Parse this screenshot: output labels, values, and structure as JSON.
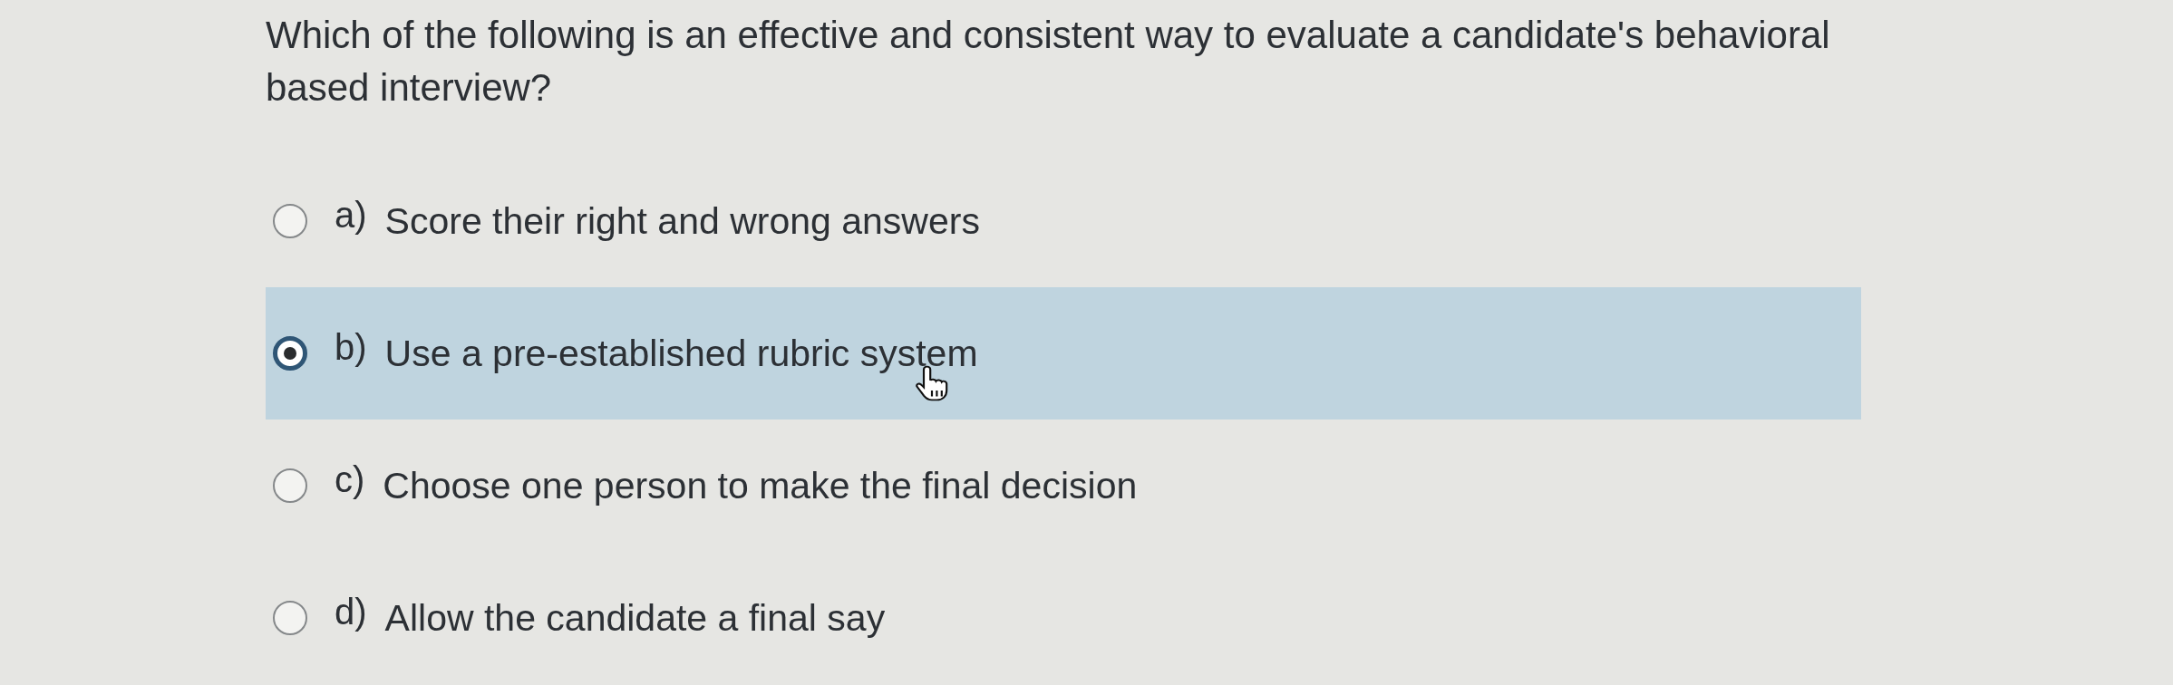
{
  "question": {
    "text": "Which of the following is an effective and consistent way to evaluate a candidate's behavioral based interview?"
  },
  "options": [
    {
      "letter": "a)",
      "text": "Score their right and wrong answers",
      "selected": false
    },
    {
      "letter": "b)",
      "text": "Use a pre-established rubric system",
      "selected": true
    },
    {
      "letter": "c)",
      "text": "Choose one person to make the final decision",
      "selected": false
    },
    {
      "letter": "d)",
      "text": "Allow the candidate a final say",
      "selected": false
    }
  ]
}
